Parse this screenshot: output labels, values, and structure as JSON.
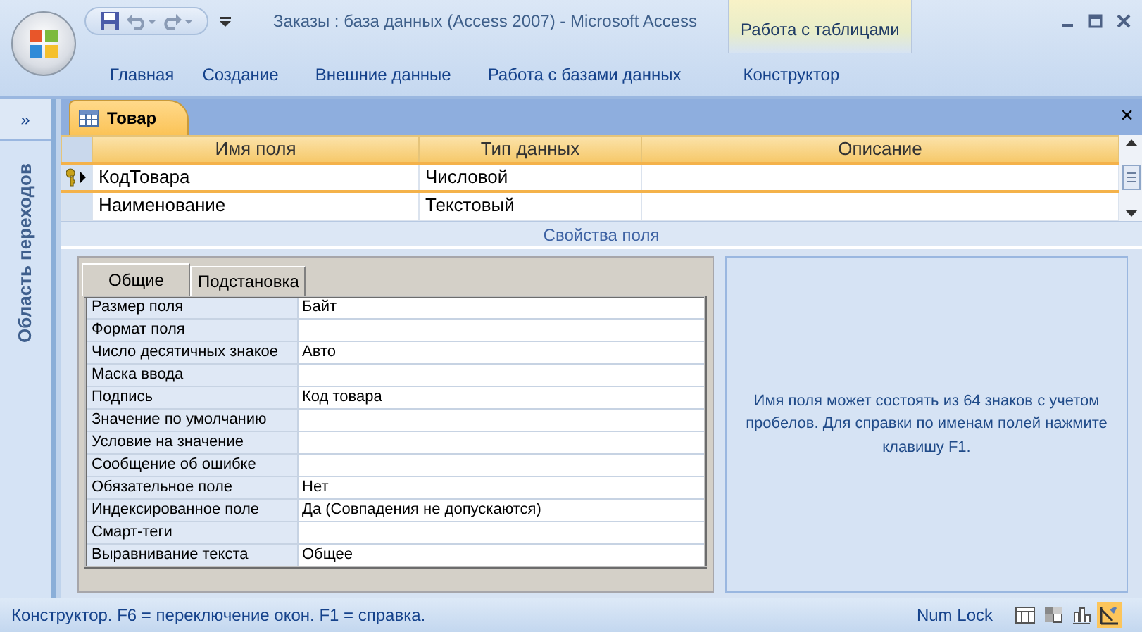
{
  "window": {
    "title": "Заказы : база данных (Access 2007)  -  Microsoft Access",
    "context_tab": "Работа с таблицами"
  },
  "ribbon_tabs": [
    {
      "label": "Главная",
      "selected": false
    },
    {
      "label": "Создание",
      "selected": false
    },
    {
      "label": "Внешние данные",
      "selected": false
    },
    {
      "label": "Работа с базами данных",
      "selected": false
    },
    {
      "label": "Конструктор",
      "selected": false
    }
  ],
  "nav_pane": {
    "toggle": "»",
    "title": "Область переходов"
  },
  "document": {
    "tab": "Товар",
    "close": "×"
  },
  "fields": {
    "columns": [
      "Имя поля",
      "Тип данных",
      "Описание"
    ],
    "rows": [
      {
        "name": "КодТовара",
        "type": "Числовой",
        "key": true,
        "selected": true
      },
      {
        "name": "Наименование",
        "type": "Текстовый",
        "key": false,
        "selected": false
      }
    ]
  },
  "section_title": "Свойства поля",
  "property_tabs": [
    {
      "label": "Общие",
      "selected": true
    },
    {
      "label": "Подстановка",
      "selected": false
    }
  ],
  "properties": [
    {
      "label": "Размер поля",
      "value": "Байт"
    },
    {
      "label": "Формат поля"
    },
    {
      "label": "Число десятичных знакое",
      "value": "Авто"
    },
    {
      "label": "Маска ввода"
    },
    {
      "label": "Подпись",
      "value": "Код товара"
    },
    {
      "label": "Значение по умолчанию"
    },
    {
      "label": "Условие на значение"
    },
    {
      "label": "Сообщение об ошибке"
    },
    {
      "label": "Обязательное поле",
      "value": "Нет"
    },
    {
      "label": "Индексированное поле",
      "value": "Да (Совпадения не допускаются)"
    },
    {
      "label": "Смарт-теги"
    },
    {
      "label": "Выравнивание текста",
      "value": "Общее"
    }
  ],
  "help_text": "Имя поля может состоять из 64 знаков с учетом пробелов.  Для справки по именам полей нажмите клавишу F1.",
  "status_bar": {
    "text": "Конструктор.  F6 = переключение окон.  F1 = справка.",
    "indicator": "Num Lock",
    "views": [
      {
        "kind": "datasheet",
        "selected": false
      },
      {
        "kind": "pivot-table",
        "selected": false
      },
      {
        "kind": "pivot-chart",
        "selected": false
      },
      {
        "kind": "design",
        "selected": true
      }
    ]
  }
}
